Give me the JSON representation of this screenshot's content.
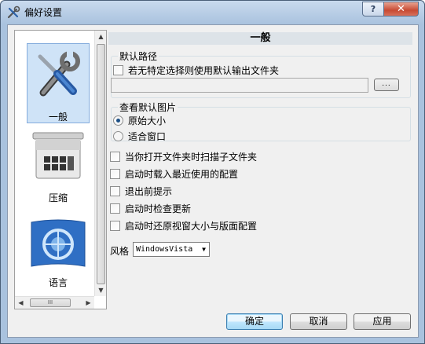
{
  "window": {
    "title": "偏好设置",
    "help_label": "?",
    "close_label": "✕"
  },
  "sidebar": {
    "items": [
      {
        "label": "一般",
        "icon": "tools-icon",
        "selected": true
      },
      {
        "label": "压缩",
        "icon": "compress-icon",
        "selected": false
      },
      {
        "label": "语言",
        "icon": "language-icon",
        "selected": false
      }
    ],
    "hscroll_grip": "III"
  },
  "section": {
    "title": "一般"
  },
  "default_path": {
    "group_title": "默认路径",
    "use_default_label": "若无特定选择则使用默认输出文件夹",
    "use_default_checked": false,
    "path_value": "",
    "browse_label": "..."
  },
  "view_default": {
    "group_title": "查看默认图片",
    "options": [
      {
        "label": "原始大小",
        "checked": true
      },
      {
        "label": "适合窗口",
        "checked": false
      }
    ]
  },
  "options": [
    {
      "label": "当你打开文件夹时扫描子文件夹",
      "checked": false
    },
    {
      "label": "启动时载入最近使用的配置",
      "checked": false
    },
    {
      "label": "退出前提示",
      "checked": false
    },
    {
      "label": "启动时检查更新",
      "checked": false
    },
    {
      "label": "启动时还原视窗大小与版面配置",
      "checked": false
    }
  ],
  "style": {
    "label": "风格",
    "value": "WindowsVista"
  },
  "buttons": {
    "ok": "确定",
    "cancel": "取消",
    "apply": "应用"
  },
  "colors": {
    "selection": "#cfe3f7",
    "default_button": "#3c7fb1"
  }
}
